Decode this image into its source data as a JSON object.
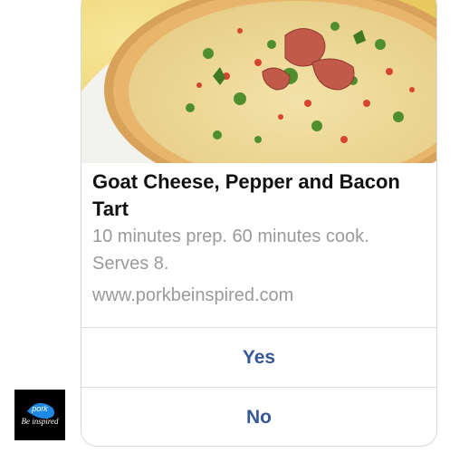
{
  "card": {
    "image_alt": "Goat cheese, pepper and bacon tart",
    "title": "Goat Cheese, Pepper and Bacon Tart",
    "subtitle": "10 minutes prep. 60 minutes cook. Serves 8.",
    "url": "www.porkbeinspired.com"
  },
  "actions": [
    {
      "label": "Yes"
    },
    {
      "label": "No"
    }
  ],
  "avatar": {
    "line1": "pork",
    "line2": "Be inspired"
  },
  "colors": {
    "button_text": "#365899",
    "muted_text": "#9a9a9a",
    "avatar_accent": "#1e88e5"
  }
}
